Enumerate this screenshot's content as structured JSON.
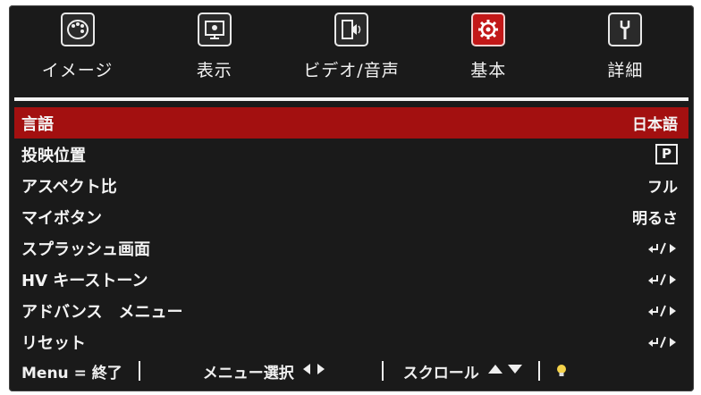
{
  "tabs": [
    {
      "label": "イメージ",
      "icon": "palette-icon",
      "active": false
    },
    {
      "label": "表示",
      "icon": "display-icon",
      "active": false
    },
    {
      "label": "ビデオ/音声",
      "icon": "video-audio-icon",
      "active": false
    },
    {
      "label": "基本",
      "icon": "gear-icon",
      "active": true
    },
    {
      "label": "詳細",
      "icon": "wrench-icon",
      "active": false
    }
  ],
  "menu": [
    {
      "label": "言語",
      "value": "日本語",
      "selected": true
    },
    {
      "label": "投映位置",
      "value": "P",
      "selected": false
    },
    {
      "label": "アスペクト比",
      "value": "フル",
      "selected": false
    },
    {
      "label": "マイボタン",
      "value": "明るさ",
      "selected": false
    },
    {
      "label": "スプラッシュ画面",
      "value": "enter-arrow-icon",
      "selected": false
    },
    {
      "label": "HV キーストーン",
      "value": "enter-arrow-icon",
      "selected": false
    },
    {
      "label": "アドバンス　メニュー",
      "value": "enter-arrow-icon",
      "selected": false
    },
    {
      "label": "リセット",
      "value": "enter-arrow-icon",
      "selected": false
    }
  ],
  "footer": {
    "exit": "Menu = 終了",
    "select": "メニュー選択",
    "scroll": "スクロール"
  },
  "colors": {
    "background": "#1a1a1a",
    "accent": "#a31010",
    "text": "#f4f4f4"
  }
}
